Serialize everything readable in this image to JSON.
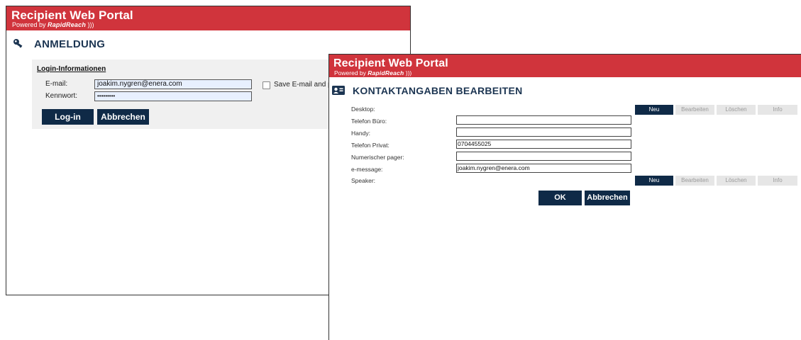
{
  "login_window": {
    "portal_title": "Recipient Web Portal",
    "powered_prefix": "Powered by ",
    "powered_brand": "RapidReach",
    "powered_suffix": " )))",
    "heading": "ANMELDUNG",
    "heading_icon": "key-icon",
    "section_title": "Login-Informationen",
    "email_label": "E-mail:",
    "email_value": "joakim.nygren@enera.com",
    "password_label": "Kennwort:",
    "password_value": "•••••••••",
    "save_label": "Save E-mail and p",
    "login_button": "Log-in",
    "cancel_button": "Abbrechen"
  },
  "contact_window": {
    "portal_title": "Recipient Web Portal",
    "powered_prefix": "Powered by ",
    "powered_brand": "RapidReach",
    "powered_suffix": " )))",
    "heading": "KONTAKTANGABEN BEARBEITEN",
    "heading_icon": "contact-card-icon",
    "desktop_label": "Desktop:",
    "fields": [
      {
        "label": "Telefon Büro:",
        "value": ""
      },
      {
        "label": "Handy:",
        "value": ""
      },
      {
        "label": "Telefon Privat:",
        "value": "0704455025"
      },
      {
        "label": "Numerischer pager:",
        "value": ""
      },
      {
        "label": "e-message:",
        "value": "joakim.nygren@enera.com"
      }
    ],
    "speaker_label": "Speaker:",
    "actions": {
      "new": "Neu",
      "edit": "Bearbeiten",
      "delete": "Löschen",
      "info": "Info"
    },
    "ok_button": "OK",
    "cancel_button": "Abbrechen"
  },
  "colors": {
    "banner_red": "#d0343c",
    "navy": "#0f2a47",
    "heading_blue": "#1c3552",
    "panel_gray": "#f0f0f0"
  }
}
